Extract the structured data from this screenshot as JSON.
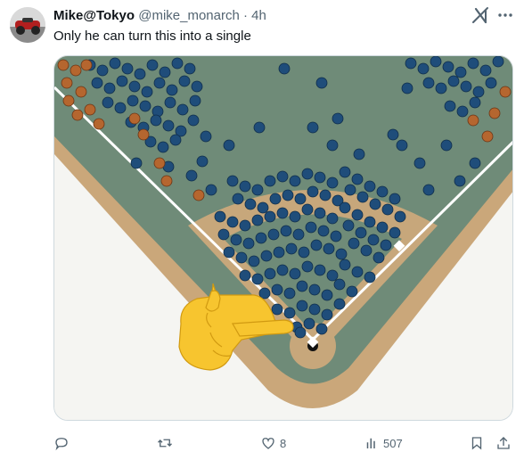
{
  "author": {
    "display_name": "Mike@Tokyo",
    "handle": "@mike_monarch",
    "separator": "·",
    "time": "4h"
  },
  "tweet": {
    "text": "Only he can turn this into a single"
  },
  "media": {
    "emoji": "pointing-hand-emoji"
  },
  "actions": {
    "reply_count": "",
    "retweet_count": "",
    "like_count": "8",
    "views_count": "507"
  },
  "icons": {
    "grok": "grok-icon",
    "more": "more-icon",
    "reply": "reply-icon",
    "retweet": "retweet-icon",
    "like": "heart-icon",
    "views": "views-icon",
    "bookmark": "bookmark-icon",
    "share": "share-icon"
  },
  "colors": {
    "text_primary": "#0f1419",
    "text_secondary": "#536471",
    "field_green": "#6f8b78",
    "infield_dirt": "#c7a77b",
    "ball_blue": "#1f4d7a",
    "ball_orange": "#b5662f"
  }
}
